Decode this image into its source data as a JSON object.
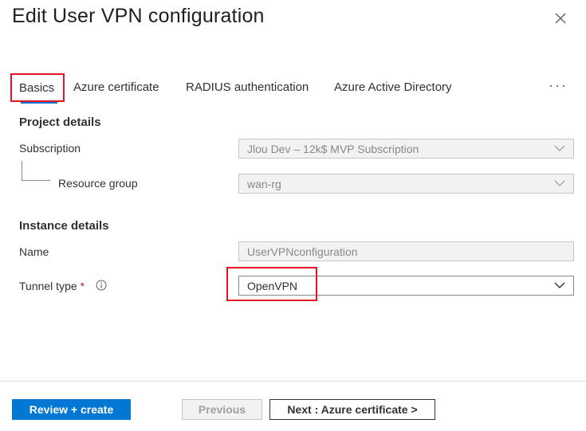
{
  "header": {
    "title": "Edit User VPN configuration",
    "close_icon": "close-icon"
  },
  "tabs": [
    {
      "label": "Basics"
    },
    {
      "label": "Azure certificate"
    },
    {
      "label": "RADIUS authentication"
    },
    {
      "label": "Azure Active Directory"
    }
  ],
  "more_label": "···",
  "project": {
    "heading": "Project details",
    "subscription_label": "Subscription",
    "subscription_value": "Jlou Dev – 12k$ MVP Subscription",
    "resource_group_label": "Resource group",
    "resource_group_value": "wan-rg"
  },
  "instance": {
    "heading": "Instance details",
    "name_label": "Name",
    "name_value": "UserVPNconfiguration",
    "tunnel_label": "Tunnel type",
    "tunnel_required": "*",
    "tunnel_value": "OpenVPN"
  },
  "footer": {
    "review_label": "Review + create",
    "previous_label": "Previous",
    "next_label": "Next : Azure certificate >"
  },
  "colors": {
    "accent": "#0078d4",
    "highlight": "#e81123",
    "required": "#a4262c"
  }
}
